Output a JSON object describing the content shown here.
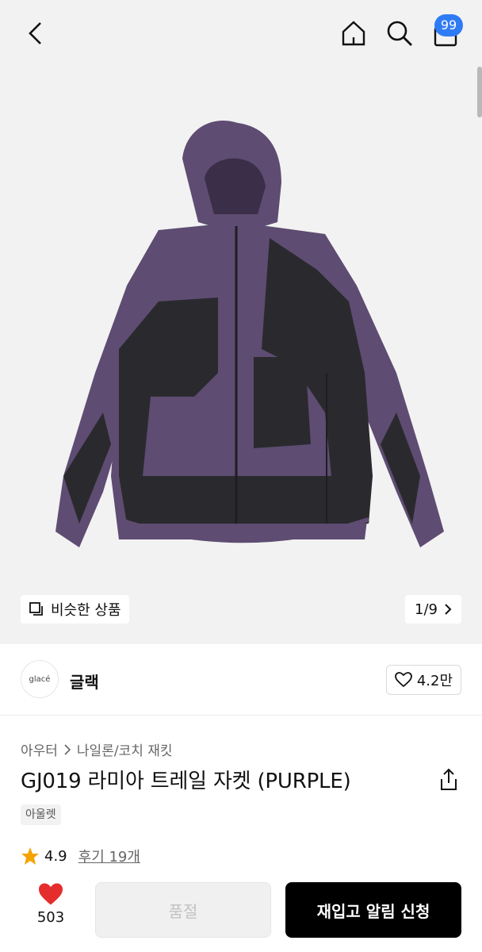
{
  "header": {
    "cart_count": "99"
  },
  "gallery": {
    "similar_label": "비슷한 상품",
    "counter": "1/9"
  },
  "brand": {
    "logo_text": "glacé",
    "name": "글랙",
    "likes": "4.2만"
  },
  "product": {
    "breadcrumb": [
      "아우터",
      "나일론/코치 재킷"
    ],
    "title": "GJ019 라미아 트레일 자켓 (PURPLE)",
    "tag": "아울렛",
    "rating": "4.9",
    "reviews": "후기 19개"
  },
  "bottom_bar": {
    "heart_count": "503",
    "soldout_label": "품절",
    "restock_label": "재입고 알림 신청"
  },
  "colors": {
    "accent": "#2f7bf5",
    "heart": "#e52d2d",
    "star": "#f4a300",
    "jacket_purple": "#5e4c72",
    "jacket_black": "#2a2a2e"
  }
}
